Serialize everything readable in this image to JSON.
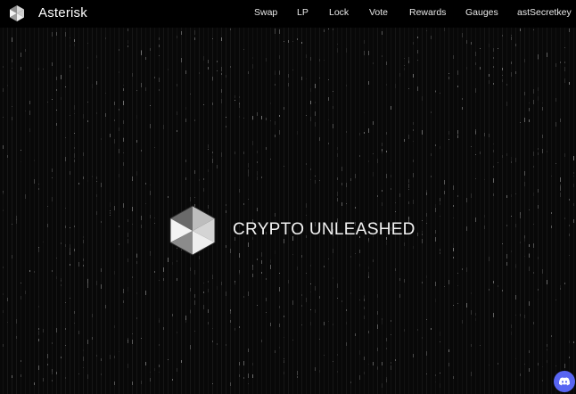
{
  "header": {
    "brand_name": "Asterisk",
    "logo_icon": "hexagon-cube-logo-icon",
    "nav_items": [
      "Swap",
      "LP",
      "Lock",
      "Vote",
      "Rewards",
      "Gauges",
      "astSecretkey"
    ]
  },
  "hero": {
    "logo_icon": "hexagon-cube-logo-icon",
    "title": "CRYPTO UNLEASHED"
  },
  "floating": {
    "discord_icon": "discord-icon"
  },
  "colors": {
    "background": "#080808",
    "navbar": "#000000",
    "text": "#ffffff",
    "discord": "#5865f2"
  }
}
